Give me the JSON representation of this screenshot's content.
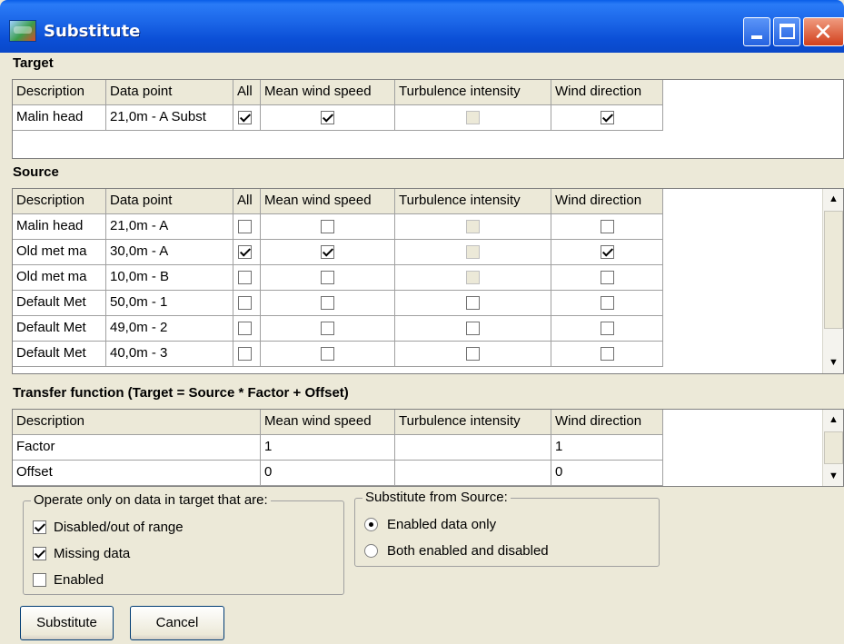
{
  "window": {
    "title": "Substitute"
  },
  "target": {
    "label": "Target",
    "headers": [
      "Description",
      "Data point",
      "All",
      "Mean wind speed",
      "Turbulence intensity",
      "Wind direction"
    ],
    "rows": [
      {
        "description": "Malin head",
        "data_point": "21,0m - A Subst",
        "all": true,
        "mean": true,
        "turb": false,
        "turb_disabled": true,
        "dir": true
      }
    ]
  },
  "source": {
    "label": "Source",
    "headers": [
      "Description",
      "Data point",
      "All",
      "Mean wind speed",
      "Turbulence intensity",
      "Wind direction"
    ],
    "rows": [
      {
        "description": "Malin head",
        "data_point": "21,0m - A",
        "all": false,
        "mean": false,
        "dir": false
      },
      {
        "description": "Old met ma",
        "data_point": "30,0m - A",
        "all": true,
        "mean": true,
        "dir": true
      },
      {
        "description": "Old met ma",
        "data_point": "10,0m - B",
        "all": false,
        "mean": false,
        "dir": false
      },
      {
        "description": "Default Met",
        "data_point": "50,0m - 1",
        "all": false,
        "mean": false,
        "dir": false
      },
      {
        "description": "Default Met",
        "data_point": "49,0m - 2",
        "all": false,
        "mean": false,
        "dir": false
      },
      {
        "description": "Default Met",
        "data_point": "40,0m - 3",
        "all": false,
        "mean": false,
        "dir": false
      }
    ]
  },
  "transfer": {
    "label": "Transfer function  (Target = Source * Factor + Offset)",
    "headers": [
      "Description",
      "Mean wind speed",
      "Turbulence intensity",
      "Wind direction"
    ],
    "rows": [
      {
        "description": "Factor",
        "mean": "1",
        "turb": "",
        "dir": "1"
      },
      {
        "description": "Offset",
        "mean": "0",
        "turb": "",
        "dir": "0"
      }
    ]
  },
  "operate_group": {
    "title": "Operate only on data in target that are:",
    "options": [
      {
        "label": "Disabled/out of range",
        "checked": true
      },
      {
        "label": "Missing data",
        "checked": true
      },
      {
        "label": "Enabled",
        "checked": false
      }
    ]
  },
  "substitute_group": {
    "title": "Substitute from Source:",
    "options": [
      {
        "label": "Enabled data only",
        "selected": true
      },
      {
        "label": "Both enabled and disabled",
        "selected": false
      }
    ]
  },
  "buttons": {
    "substitute": "Substitute",
    "cancel": "Cancel"
  },
  "icons": {
    "scroll_up": "scroll-up-arrow-icon",
    "scroll_down": "scroll-down-arrow-icon"
  }
}
